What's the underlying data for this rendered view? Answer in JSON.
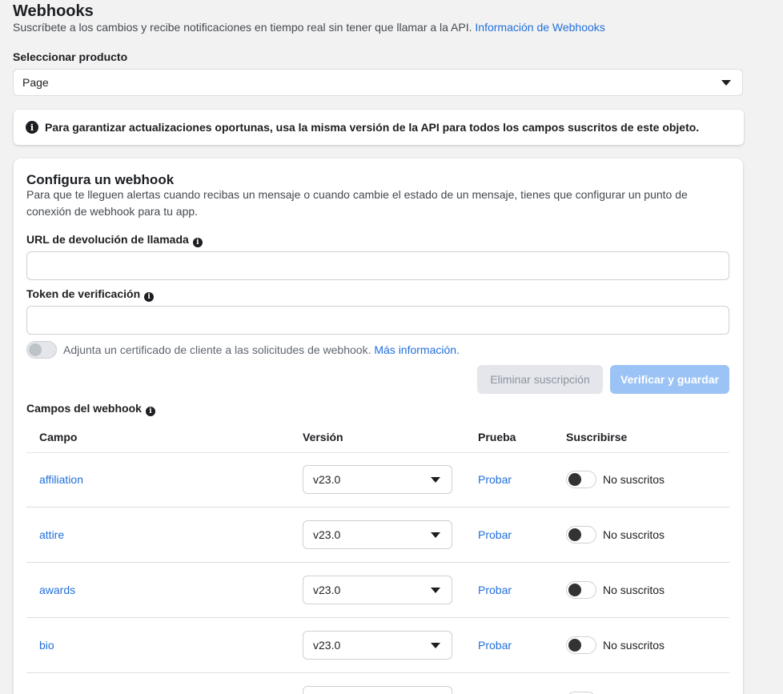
{
  "header": {
    "title": "Webhooks",
    "subtitle": "Suscríbete a los cambios y recibe notificaciones en tiempo real sin tener que llamar a la API.",
    "info_link": "Información de Webhooks"
  },
  "product": {
    "label": "Seleccionar producto",
    "selected": "Page"
  },
  "notice": {
    "text": "Para garantizar actualizaciones oportunas, usa la misma versión de la API para todos los campos suscritos de este objeto."
  },
  "config": {
    "title": "Configura un webhook",
    "description": "Para que te lleguen alertas cuando recibas un mensaje o cuando cambie el estado de un mensaje, tienes que configurar un punto de conexión de webhook para tu app.",
    "callback_label": "URL de devolución de llamada",
    "callback_value": "",
    "token_label": "Token de verificación",
    "token_value": "",
    "cert_text": "Adjunta un certificado de cliente a las solicitudes de webhook.",
    "cert_link": "Más información.",
    "delete_button": "Eliminar suscripción",
    "verify_button": "Verificar y guardar"
  },
  "fields": {
    "label": "Campos del webhook",
    "columns": [
      "Campo",
      "Versión",
      "Prueba",
      "Suscribirse"
    ],
    "rows": [
      {
        "field": "affiliation",
        "version": "v23.0",
        "test": "Probar",
        "status": "No suscritos"
      },
      {
        "field": "attire",
        "version": "v23.0",
        "test": "Probar",
        "status": "No suscritos"
      },
      {
        "field": "awards",
        "version": "v23.0",
        "test": "Probar",
        "status": "No suscritos"
      },
      {
        "field": "bio",
        "version": "v23.0",
        "test": "Probar",
        "status": "No suscritos"
      },
      {
        "field": "",
        "version": "",
        "test": "",
        "status": ""
      }
    ]
  },
  "colors": {
    "link": "#216fdb",
    "verify_button": "#9cc3f5",
    "background": "#f2f2f2"
  }
}
